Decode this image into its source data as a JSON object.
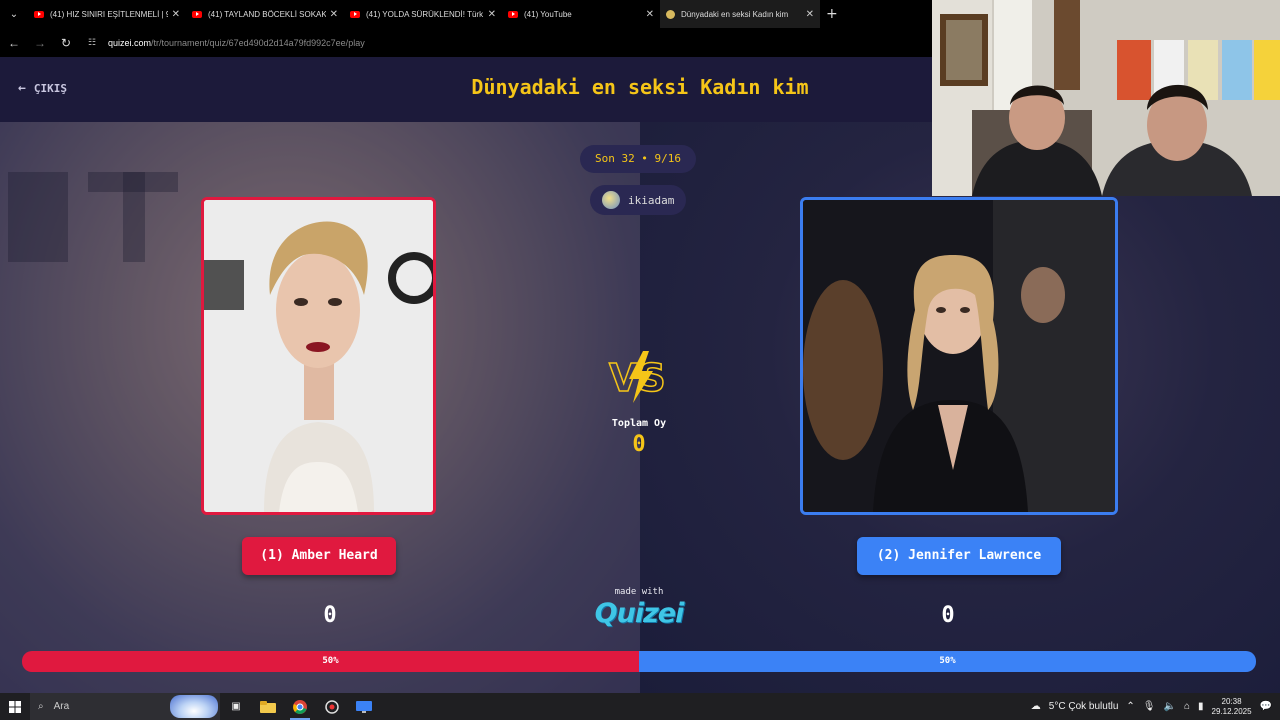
{
  "browser": {
    "tabs": [
      {
        "title": "(41) HIZ SINIRI EŞİTLENMELİ | 9",
        "icon": "youtube-icon",
        "active": false
      },
      {
        "title": "(41) TAYLAND BÖCEKLİ SOKAK",
        "icon": "youtube-icon",
        "active": false
      },
      {
        "title": "(41) YOLDA SÜRÜKLENDİ! Türk",
        "icon": "youtube-icon",
        "active": false
      },
      {
        "title": "(41) YouTube",
        "icon": "youtube-icon",
        "active": false
      },
      {
        "title": "Dünyadaki en seksi Kadın kim",
        "icon": "quizei-icon",
        "active": true
      }
    ],
    "new_tab": "+",
    "close": "✕",
    "url_domain": "quizei.com",
    "url_path": "/tr/tournament/quiz/67ed490d2d14a79fd992c7ee/play"
  },
  "header": {
    "exit_label": "ÇIKIŞ",
    "title": "Dünyadaki en seksi Kadın kim"
  },
  "round": {
    "label": "Son 32 • 9/16"
  },
  "user": {
    "name": "ikiadam"
  },
  "contestants": {
    "left": {
      "label": "(1) Amber Heard",
      "score": "0",
      "percent_label": "50%",
      "percent": 50,
      "color": "#e0193f"
    },
    "right": {
      "label": "(2) Jennifer Lawrence",
      "score": "0",
      "percent_label": "50%",
      "percent": 50,
      "color": "#3b82f6"
    }
  },
  "votes": {
    "label": "Toplam Oy",
    "value": "0"
  },
  "branding": {
    "made_with": "made with",
    "logo": "Quizei"
  },
  "taskbar": {
    "search_placeholder": "Ara",
    "weather": "5°C  Çok bulutlu",
    "time": "20:38",
    "date": "29.12.2025"
  },
  "colors": {
    "accent": "#f5c518",
    "left": "#e0193f",
    "right": "#3b82f6",
    "background": "#1d1b3d"
  }
}
